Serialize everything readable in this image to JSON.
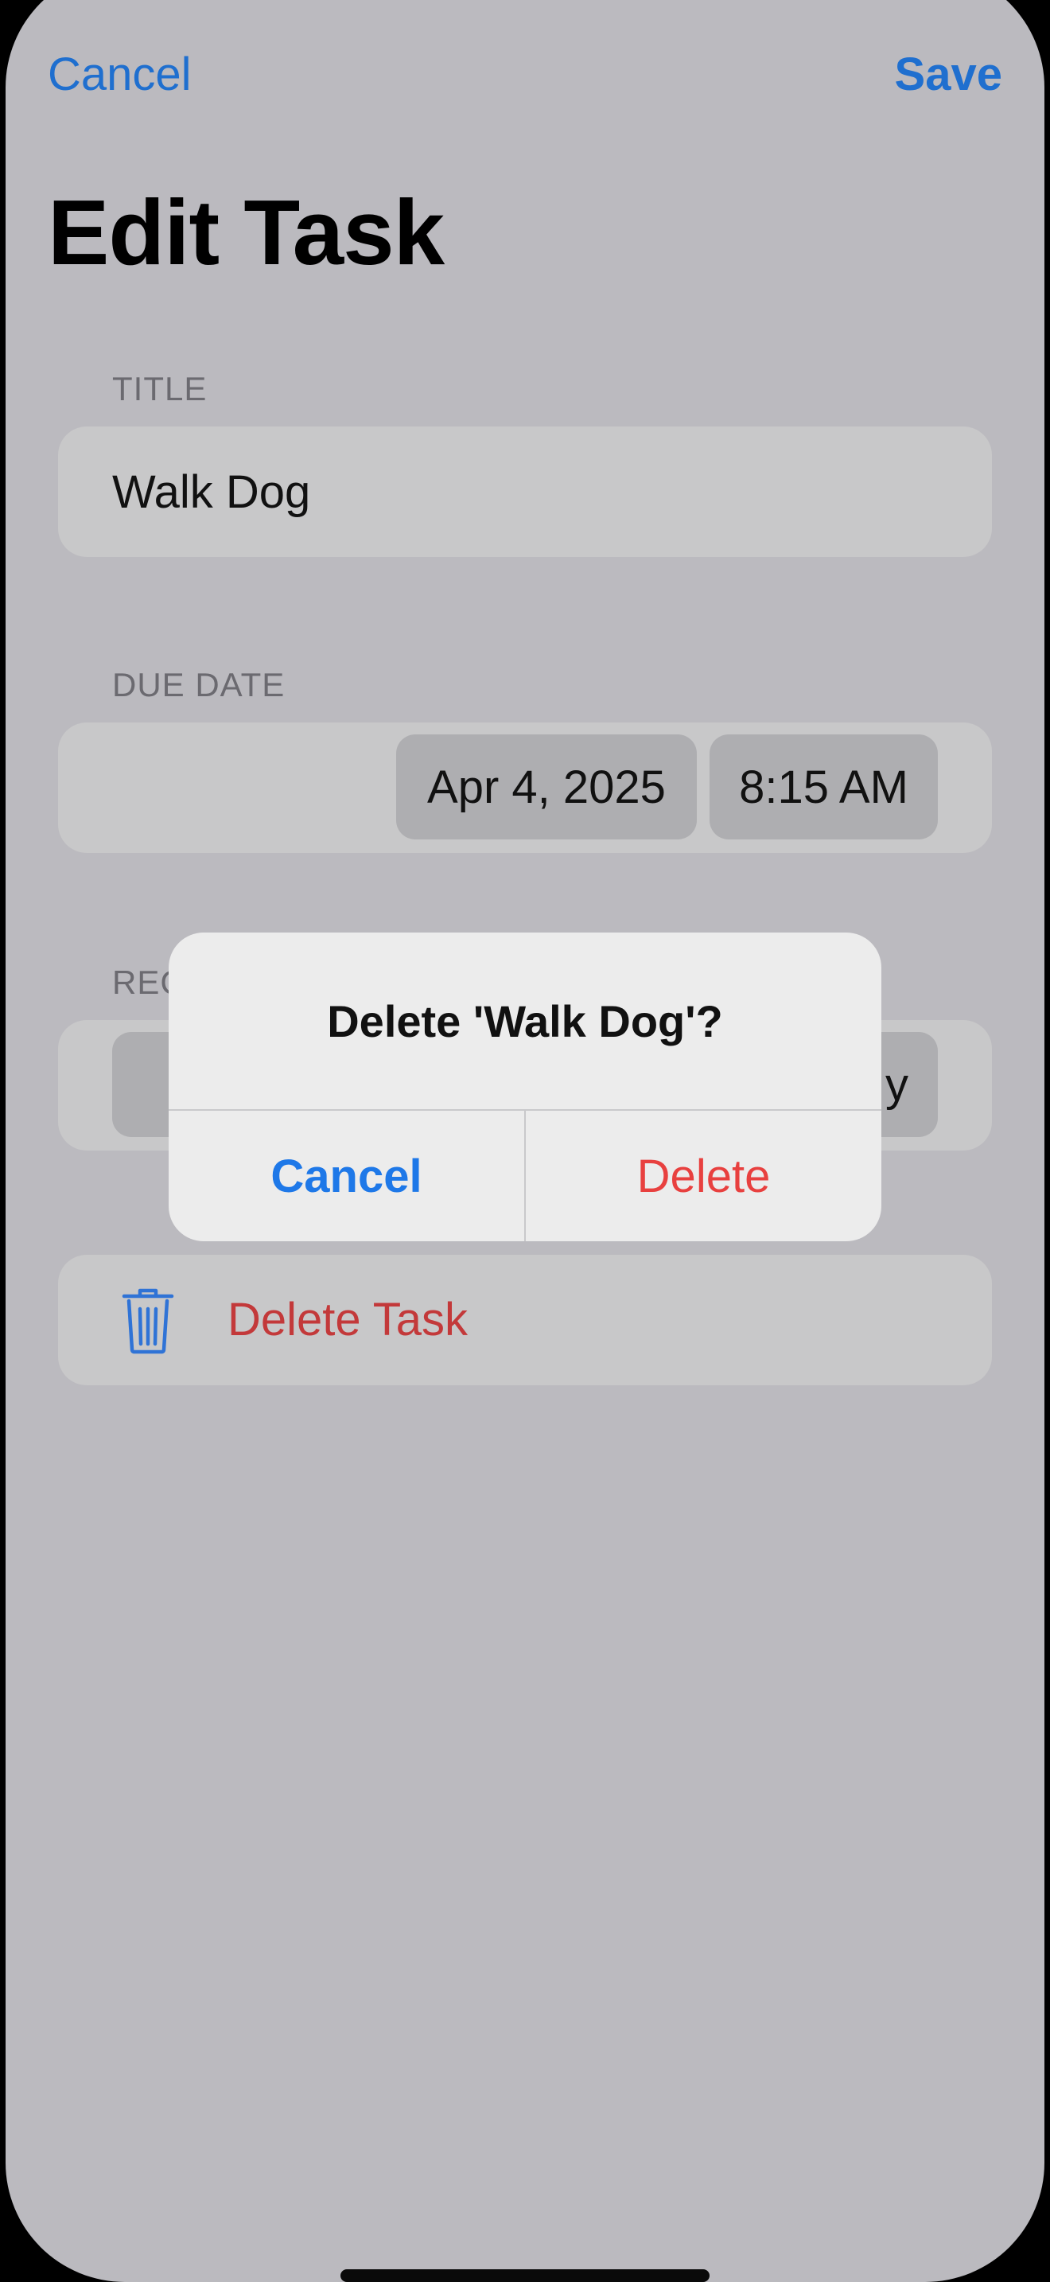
{
  "nav": {
    "cancel_label": "Cancel",
    "save_label": "Save"
  },
  "page": {
    "title": "Edit Task"
  },
  "sections": {
    "title_header": "TITLE",
    "due_date_header": "DUE DATE",
    "recurrence_header_partial": "REC"
  },
  "form": {
    "title_value": "Walk Dog",
    "due_date": "Apr 4, 2025",
    "due_time": "8:15 AM",
    "recurrence_partial_value": "y"
  },
  "delete_row": {
    "label": "Delete Task",
    "icon": "trash-icon"
  },
  "alert": {
    "title": "Delete 'Walk Dog'?",
    "cancel_label": "Cancel",
    "delete_label": "Delete"
  },
  "colors": {
    "accent_blue": "#1f6fcf",
    "destructive_red": "#e8403f",
    "dimmed_background": "#bbbabf"
  }
}
